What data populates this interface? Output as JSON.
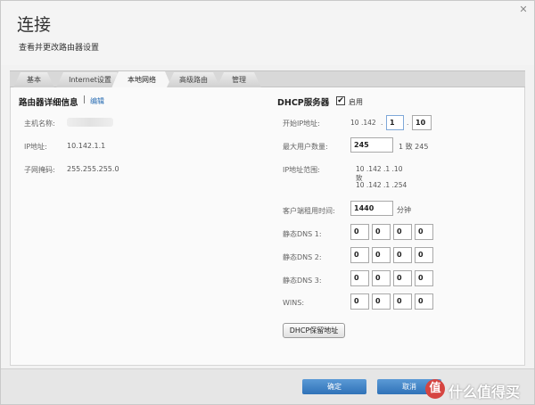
{
  "window": {
    "title": "连接",
    "subtitle": "查看并更改路由器设置",
    "close_glyph": "✕"
  },
  "tabs": [
    "基本",
    "Internet设置",
    "本地网络",
    "高级路由",
    "管理"
  ],
  "router_details": {
    "heading": "路由器详细信息",
    "separator": "|",
    "edit_label": "编辑",
    "hostname_label": "主机名称:",
    "ip_label": "IP地址:",
    "ip_value": "10.142.1.1",
    "subnet_label": "子网掩码:",
    "subnet_value": "255.255.255.0"
  },
  "dhcp": {
    "heading": "DHCP服务器",
    "enabled_label": "启用",
    "enabled_checked": "✔",
    "start_ip_label": "开始IP地址:",
    "start_ip_fixed1": "10",
    "start_ip_fixed2": ".142",
    "start_ip_dot1": ".",
    "start_ip_oct3": "1",
    "start_ip_dot2": ".",
    "start_ip_oct4": "10",
    "max_users_label": "最大用户数量:",
    "max_users_value": "245",
    "max_users_range": "1 致 245",
    "ip_range_label": "IP地址范围:",
    "ip_range_line1": "10 .142 .1 .10",
    "ip_range_line2": "致",
    "ip_range_line3": "10 .142 .1 .254",
    "lease_label": "客户端租用时间:",
    "lease_value": "1440",
    "lease_unit": "分钟",
    "dns1_label": "静态DNS 1:",
    "dns1": [
      "0",
      "0",
      "0",
      "0"
    ],
    "dns2_label": "静态DNS 2:",
    "dns2": [
      "0",
      "0",
      "0",
      "0"
    ],
    "dns3_label": "静态DNS 3:",
    "dns3": [
      "0",
      "0",
      "0",
      "0"
    ],
    "wins_label": "WINS:",
    "wins": [
      "0",
      "0",
      "0",
      "0"
    ],
    "reservation_button": "DHCP保留地址"
  },
  "footer": {
    "ok_label": "确定",
    "cancel_label": "取消"
  },
  "watermark": {
    "icon_glyph": "值",
    "text": "什么值得买"
  }
}
